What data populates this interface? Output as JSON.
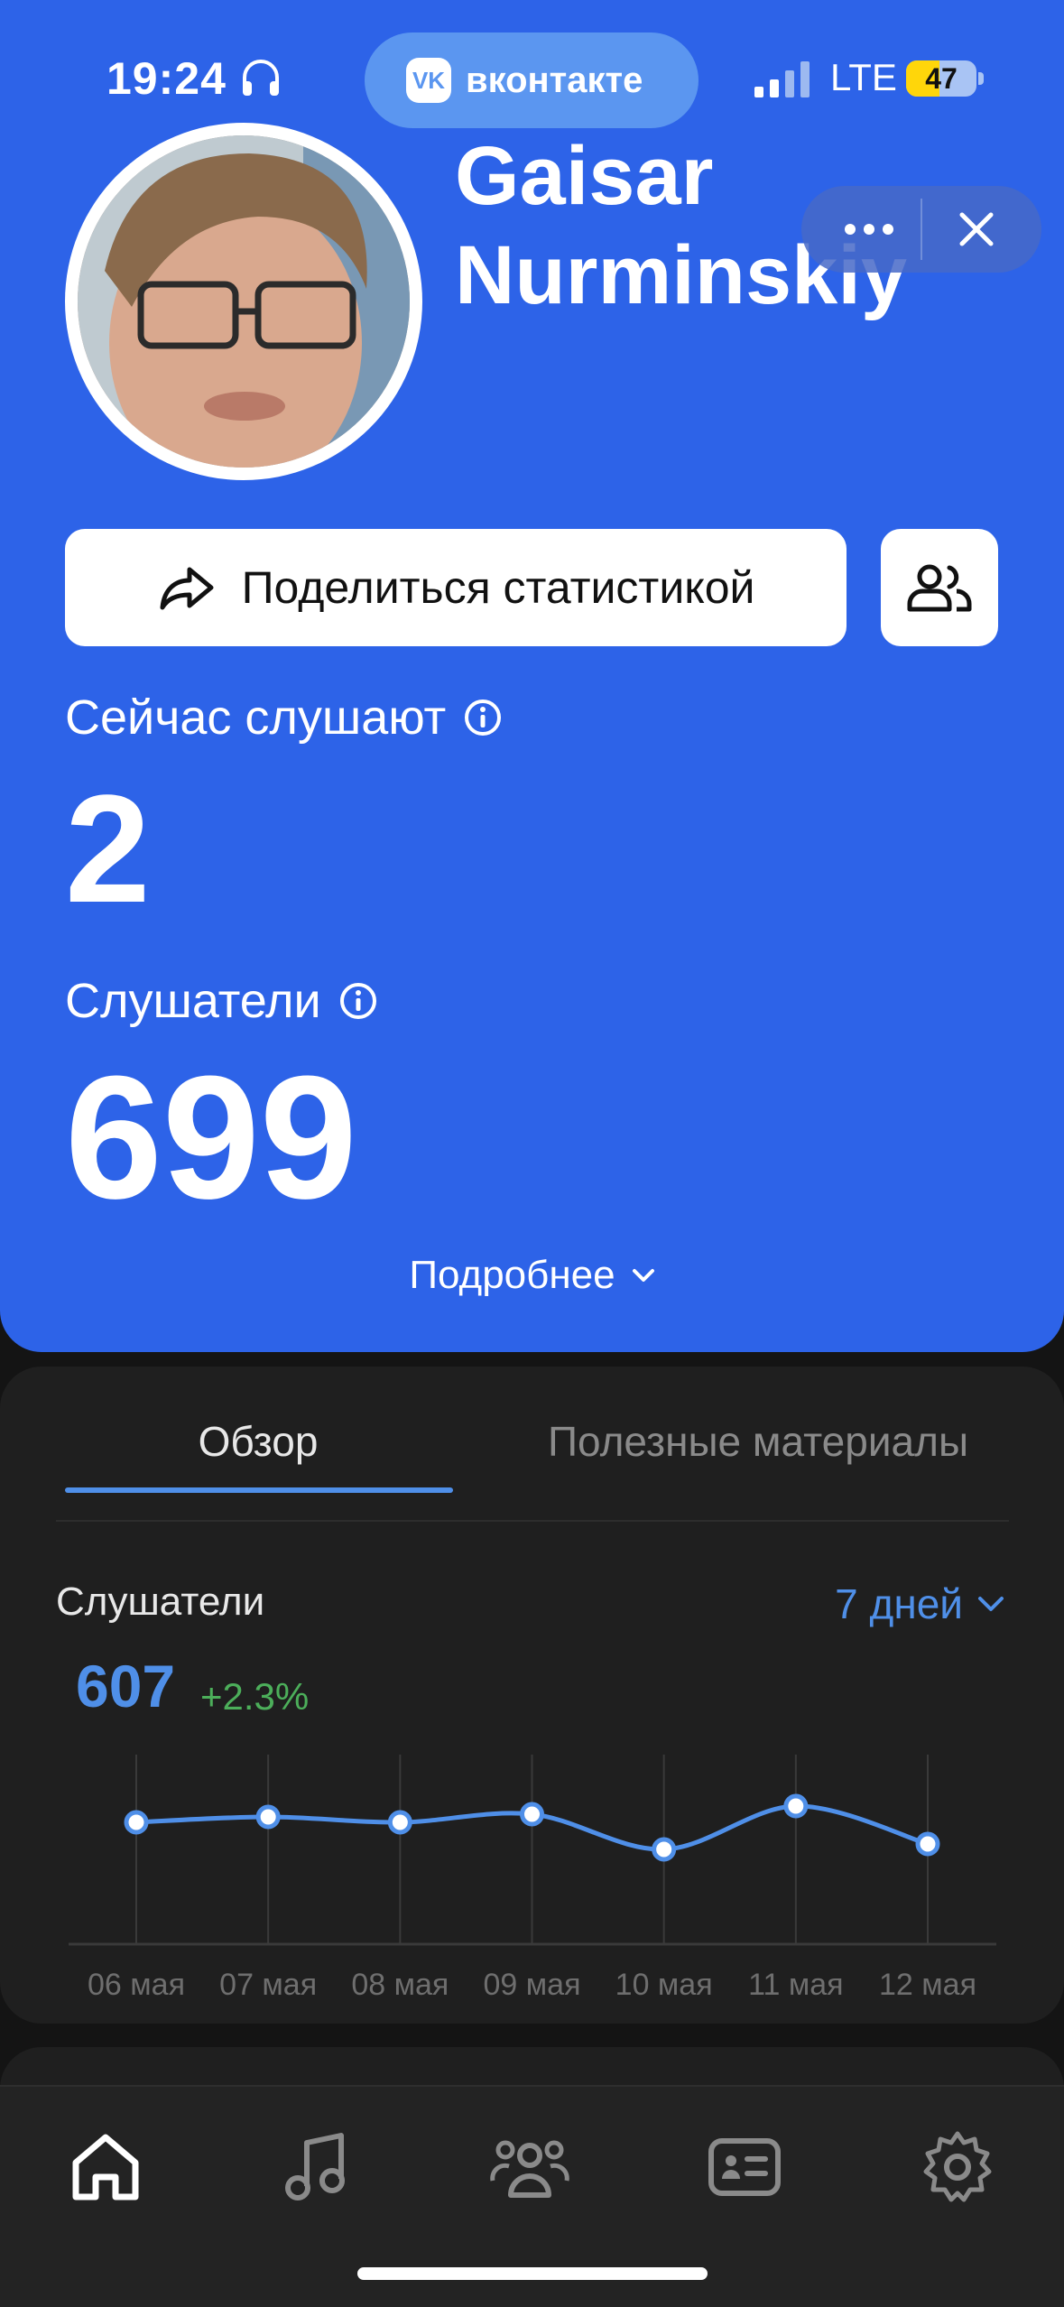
{
  "status_bar": {
    "time": "19:24",
    "app_pill": "вконтакте",
    "vk_logo_text": "VK",
    "network": "LTE",
    "battery": "47",
    "battery_level": 0.47
  },
  "profile": {
    "name_line1": "Gaisar",
    "name_line2": "Nurminskiy"
  },
  "actions": {
    "share_label": "Поделиться статистикой"
  },
  "stats": {
    "now_listening_label": "Сейчас слушают",
    "now_listening_value": "2",
    "listeners_label": "Слушатели",
    "listeners_value": "699",
    "details_label": "Подробнее"
  },
  "tabs": {
    "overview": "Обзор",
    "materials": "Полезные материалы"
  },
  "chart_section": {
    "title": "Слушатели",
    "period": "7 дней",
    "total": "607",
    "delta": "+2.3%"
  },
  "chart_data": {
    "type": "line",
    "x": [
      "06 мая",
      "07 мая",
      "08 мая",
      "09 мая",
      "10 мая",
      "11 мая",
      "12 мая"
    ],
    "series": [
      {
        "values": [
          90,
          94,
          90,
          96,
          70,
          102,
          74
        ]
      }
    ],
    "ylim": [
      0,
      140
    ],
    "grid": true,
    "colors": {
      "line": "#4f8fe8",
      "marker_fill": "#ffffff",
      "grid": "#3a3a3a"
    }
  },
  "bottom_nav": {
    "items": [
      "home-icon",
      "music-icon",
      "audience-icon",
      "profile-card-icon",
      "settings-icon"
    ],
    "active": "home-icon"
  },
  "colors": {
    "hero_blue": "#2d63e8",
    "accent": "#4f8fe8",
    "positive": "#4cae5a",
    "dark_card": "#1f1f1f"
  }
}
